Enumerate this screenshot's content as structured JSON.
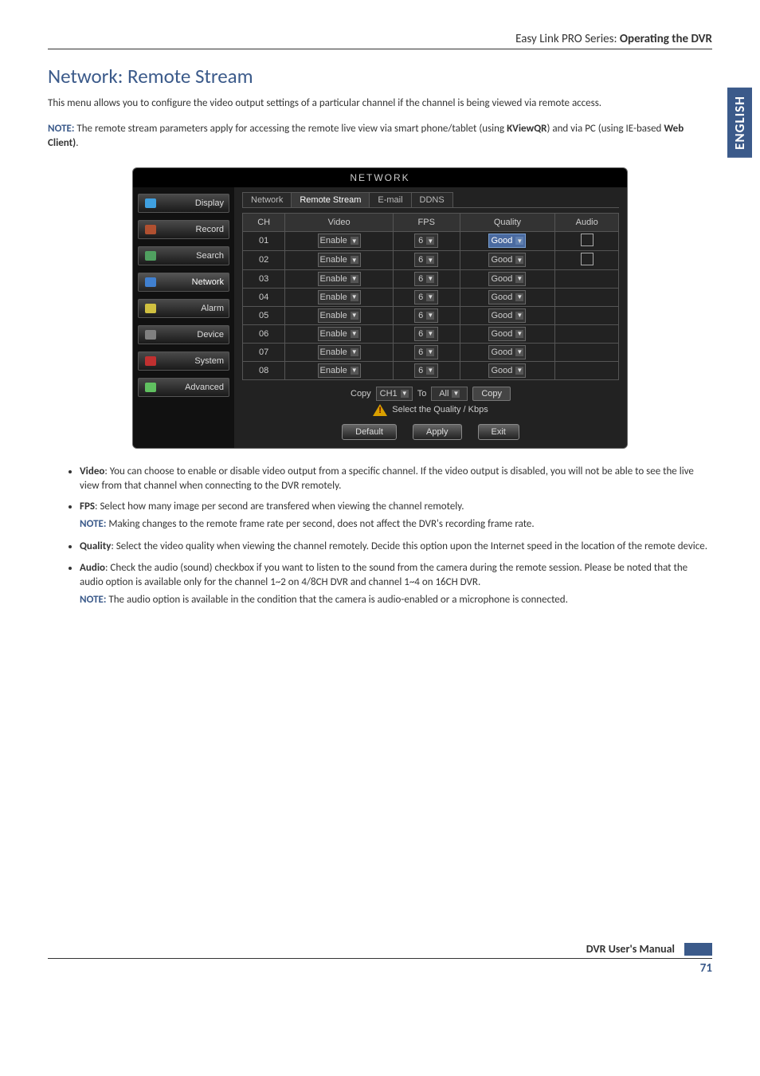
{
  "page_header": {
    "series": "Easy Link PRO Series:",
    "title": "Operating the DVR"
  },
  "side_label": "ENGLISH",
  "section_title": "Network: Remote Stream",
  "intro": "This menu allows you to configure the video output settings of a particular channel if the channel is being viewed via remote access.",
  "note_main_prefix": "NOTE:",
  "note_main": "The remote stream parameters apply for accessing the remote live view via smart phone/tablet (using ",
  "note_main_b1": "KViewQR",
  "note_main_mid": ") and via PC (using IE-based ",
  "note_main_b2": "Web Client)",
  "note_main_end": ".",
  "dvr": {
    "title": "NETWORK",
    "sidebar": [
      "Display",
      "Record",
      "Search",
      "Network",
      "Alarm",
      "Device",
      "System",
      "Advanced"
    ],
    "sidebar_active": 3,
    "tabs": [
      "Network",
      "Remote Stream",
      "E-mail",
      "DDNS"
    ],
    "tab_active": 1,
    "headers": [
      "CH",
      "Video",
      "FPS",
      "Quality",
      "Audio"
    ],
    "rows": [
      {
        "ch": "01",
        "video": "Enable",
        "fps": "6",
        "quality": "Good",
        "audio": true,
        "hl": true
      },
      {
        "ch": "02",
        "video": "Enable",
        "fps": "6",
        "quality": "Good",
        "audio": true,
        "hl": false
      },
      {
        "ch": "03",
        "video": "Enable",
        "fps": "6",
        "quality": "Good",
        "audio": false,
        "hl": false
      },
      {
        "ch": "04",
        "video": "Enable",
        "fps": "6",
        "quality": "Good",
        "audio": false,
        "hl": false
      },
      {
        "ch": "05",
        "video": "Enable",
        "fps": "6",
        "quality": "Good",
        "audio": false,
        "hl": false
      },
      {
        "ch": "06",
        "video": "Enable",
        "fps": "6",
        "quality": "Good",
        "audio": false,
        "hl": false
      },
      {
        "ch": "07",
        "video": "Enable",
        "fps": "6",
        "quality": "Good",
        "audio": false,
        "hl": false
      },
      {
        "ch": "08",
        "video": "Enable",
        "fps": "6",
        "quality": "Good",
        "audio": false,
        "hl": false
      }
    ],
    "copy_label": "Copy",
    "copy_from": "CH1",
    "copy_to_label": "To",
    "copy_to": "All",
    "copy_btn": "Copy",
    "warn_text": "Select the Quality / Kbps",
    "btn_default": "Default",
    "btn_apply": "Apply",
    "btn_exit": "Exit"
  },
  "bullets": {
    "video_t": "Video",
    "video": ": You can choose to enable or disable video output from a specific channel. If the video output is disabled, you will not be able to see the live view from that channel when connecting to the DVR remotely.",
    "fps_t": "FPS",
    "fps": ": Select how many image per second are transfered when viewing the channel remotely.",
    "fps_note_prefix": "NOTE:",
    "fps_note": "Making changes to the remote frame rate per second, does not affect the DVR's recording frame rate.",
    "quality_t": "Quality",
    "quality": ": Select the video quality when viewing the channel remotely. Decide this option upon the Internet speed in the location of the remote device.",
    "audio_t": "Audio",
    "audio": ": Check the audio (sound) checkbox if you want to listen to the sound from the camera during the remote session. Please be noted that the audio option is available only for the channel 1~2 on 4/8CH DVR and channel 1~4 on 16CH DVR.",
    "audio_note_prefix": "NOTE:",
    "audio_note": "The audio option is available in the condition that the camera is audio-enabled or a microphone is connected."
  },
  "footer_text": "DVR User's Manual",
  "page_num": "71"
}
